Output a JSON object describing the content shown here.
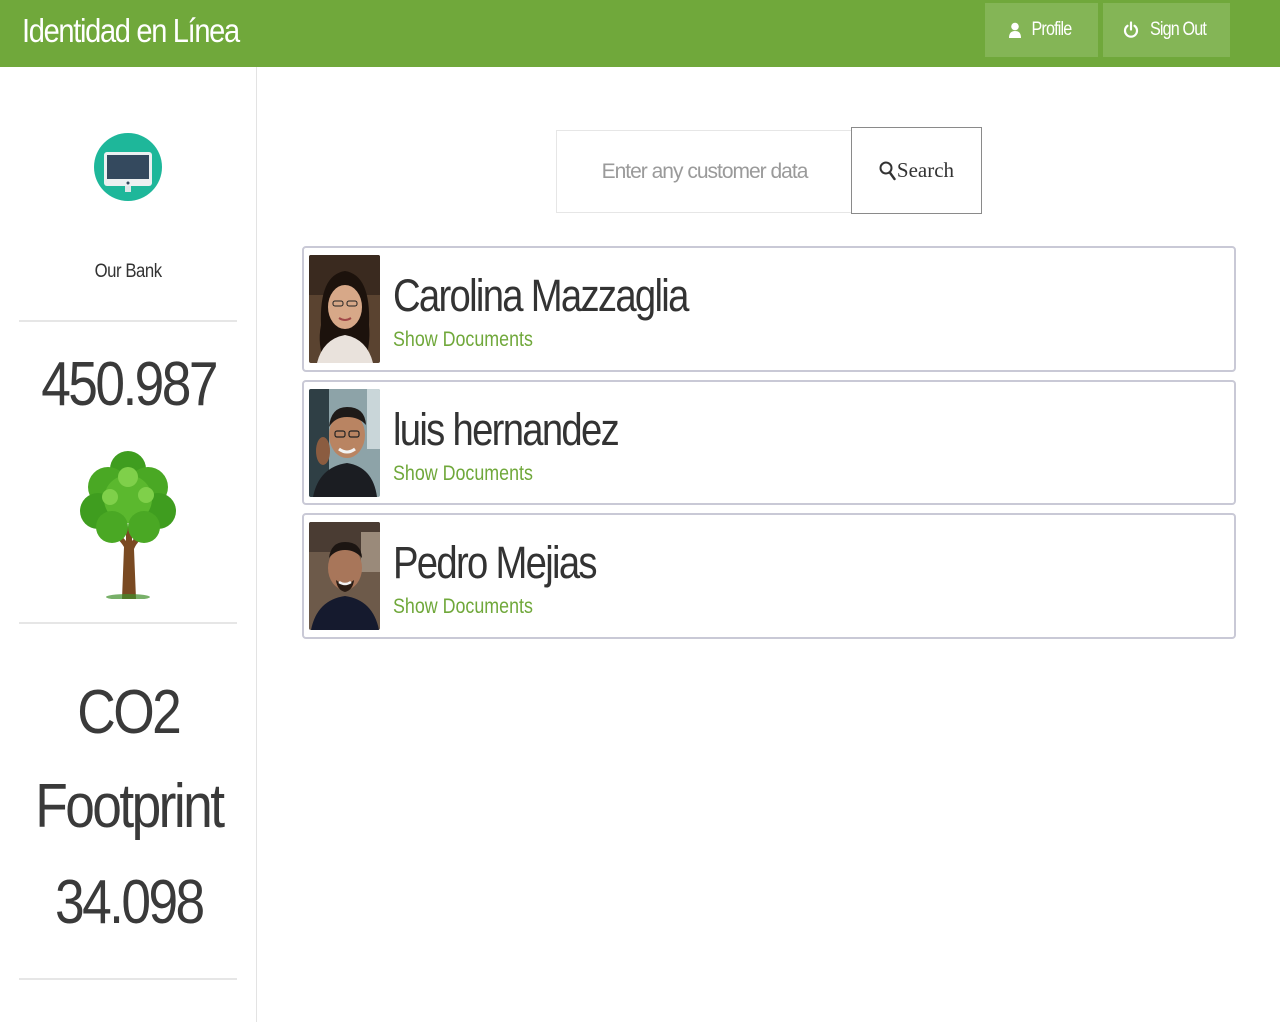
{
  "app": {
    "title": "Identidad en Línea"
  },
  "nav": {
    "profile_label": "Profile",
    "signout_label": "Sign Out"
  },
  "colors": {
    "brand_green": "#70a83b",
    "nav_button": "#84b556",
    "card_border": "#c9c9d6"
  },
  "sidebar": {
    "bank_label": "Our Bank",
    "bank_icon": "desktop-computer-icon",
    "stat_value": "450.987",
    "stat_icon": "tree-icon",
    "co2_title_line1": "CO2",
    "co2_title_line2": "Footprint",
    "co2_value": "34.098"
  },
  "search": {
    "placeholder": "Enter any customer data",
    "button_label": "Search",
    "icon": "magnifier-icon"
  },
  "customers": [
    {
      "name": "Carolina Mazzaglia",
      "link_label": "Show Documents"
    },
    {
      "name": "luis hernandez",
      "link_label": "Show Documents"
    },
    {
      "name": "Pedro Mejias",
      "link_label": "Show Documents"
    }
  ]
}
